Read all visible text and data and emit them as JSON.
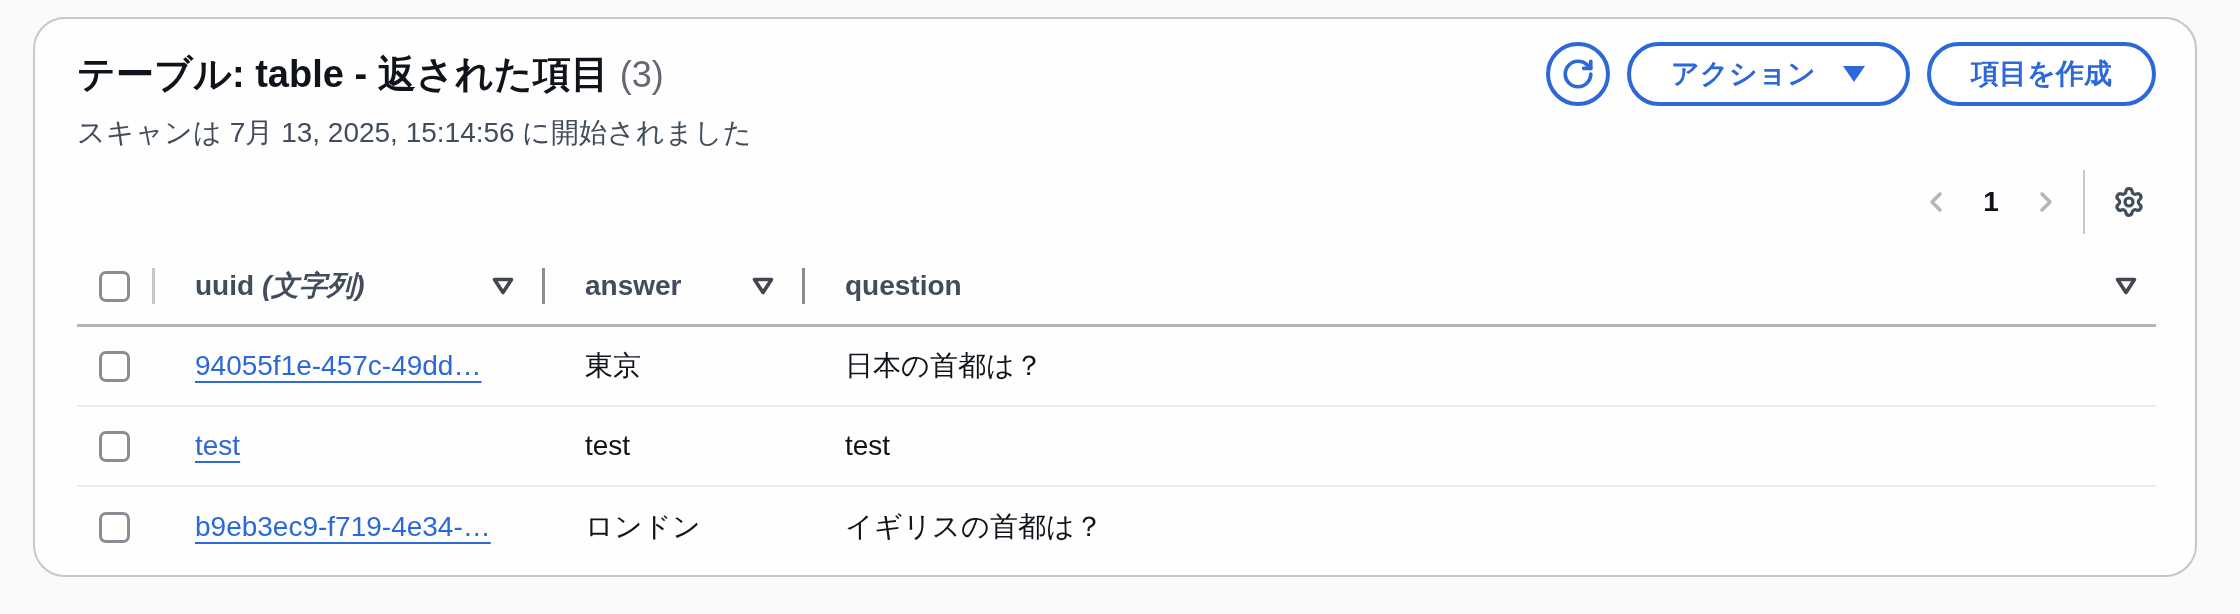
{
  "header": {
    "title": "テーブル: table - 返された項目",
    "count": "(3)",
    "subtitle": "スキャンは 7月 13, 2025, 15:14:56 に開始されました"
  },
  "actions": [
    {
      "kind": "dropdown",
      "label": "アクション"
    },
    {
      "kind": "plain",
      "label": "項目を作成"
    }
  ],
  "pagination": {
    "previous": {
      "disabled": true
    },
    "pages": [
      {
        "label": "1",
        "selected": true
      }
    ],
    "next": {
      "disabled": true
    }
  },
  "table": {
    "select_all": {
      "checked": false
    },
    "columns": [
      {
        "label": "uuid *(文字列)*"
      },
      {
        "label": "answer"
      },
      {
        "label": "question"
      }
    ],
    "rows": [
      {
        "selected": false,
        "cells": [
          {
            "kind": "link",
            "text": "94055f1e-457c-49dd…"
          },
          {
            "kind": "text",
            "text": "東京"
          },
          {
            "kind": "text",
            "text": "日本の首都は？"
          }
        ]
      },
      {
        "selected": false,
        "cells": [
          {
            "kind": "link",
            "text": "test"
          },
          {
            "kind": "text",
            "text": "test"
          },
          {
            "kind": "text",
            "text": "test"
          }
        ]
      },
      {
        "selected": false,
        "cells": [
          {
            "kind": "link",
            "text": "b9eb3ec9-f719-4e34-…"
          },
          {
            "kind": "text",
            "text": "ロンドン"
          },
          {
            "kind": "text",
            "text": "イギリスの首都は？"
          }
        ]
      }
    ]
  }
}
